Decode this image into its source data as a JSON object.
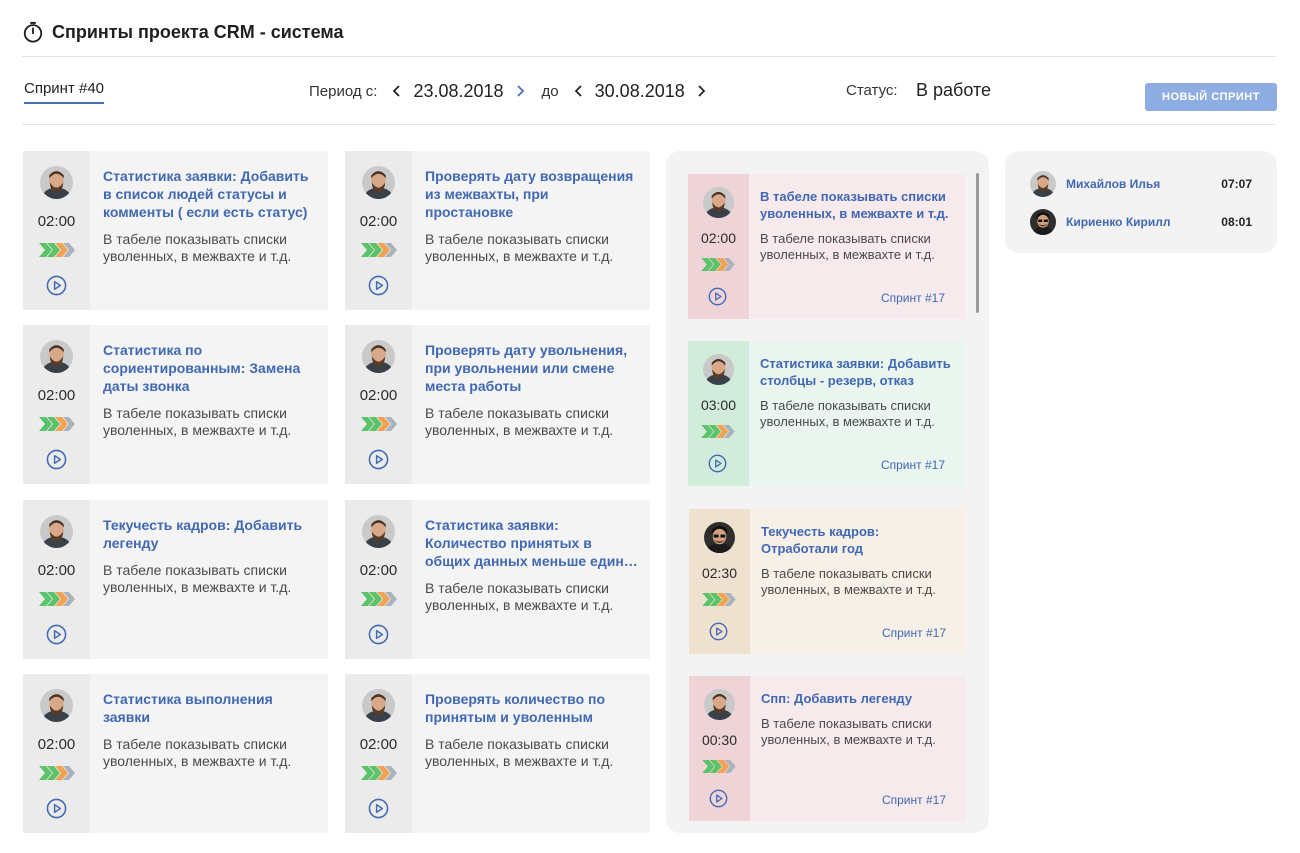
{
  "header": {
    "title": "Спринты проекта CRM - система",
    "icon": "stopwatch-icon"
  },
  "toolbar": {
    "sprint_tab": "Спринт #40",
    "period_label": "Период с:",
    "date_from": "23.08.2018",
    "to_label": "до",
    "date_to": "30.08.2018",
    "status_label": "Статус:",
    "status_value": "В работе",
    "new_sprint_button": "НОВЫЙ СПРИНТ"
  },
  "colors": {
    "accent": "#4068b3",
    "button": "#8eaee3",
    "arrow_green": "#5cc36a",
    "arrow_orange": "#f2a253",
    "arrow_gray": "#a9b3bd",
    "sprint_red_side": "#efd4d7",
    "sprint_red_body": "#f7eaec",
    "sprint_green_side": "#d2ecdc",
    "sprint_green_body": "#e9f5ee",
    "sprint_beige_side": "#efe1cf",
    "sprint_beige_body": "#f7f0e7"
  },
  "tasks": [
    {
      "time": "02:00",
      "title": "Статистика заявки: Добавить в список людей статусы и комменты ( если есть статус)",
      "desc": "В табеле показывать списки уволенных, в межвахте и т.д."
    },
    {
      "time": "02:00",
      "title": "Проверять дату возвращения из межвахты, при простановке",
      "desc": "В табеле показывать списки уволенных, в межвахте и т.д."
    },
    {
      "time": "02:00",
      "title": "Статистика по сориентированным: Замена даты звонка",
      "desc": "В табеле показывать списки уволенных, в межвахте и т.д."
    },
    {
      "time": "02:00",
      "title": "Проверять дату увольнения, при увольнении или смене места работы",
      "desc": "В табеле показывать списки уволенных, в межвахте и т.д."
    },
    {
      "time": "02:00",
      "title": "Текучесть кадров: Добавить легенду",
      "desc": "В табеле показывать списки уволенных, в межвахте и т.д."
    },
    {
      "time": "02:00",
      "title": "Статистика заявки: Количество принятых в общих данных меньше един…",
      "desc": "В табеле показывать списки уволенных, в межвахте и т.д."
    },
    {
      "time": "02:00",
      "title": "Статистика выполнения заявки",
      "desc": "В табеле показывать списки уволенных, в межвахте и т.д."
    },
    {
      "time": "02:00",
      "title": "Проверять количество по принятым и уволенным",
      "desc": "В табеле показывать списки уволенных, в межвахте и т.д."
    }
  ],
  "sprint_tasks": [
    {
      "time": "02:00",
      "title": "В табеле показывать списки уволенных, в межвахте и т.д.",
      "desc": "В табеле показывать списки уволенных, в межвахте и т.д.",
      "tag": "Спринт #17",
      "color": "red"
    },
    {
      "time": "03:00",
      "title": "Статистика заявки: Добавить столбцы - резерв, отказ",
      "desc": "В табеле показывать списки уволенных, в межвахте и т.д.",
      "tag": "Спринт #17",
      "color": "green"
    },
    {
      "time": "02:30",
      "title": "Текучесть кадров: Отработали год",
      "desc": "В табеле показывать списки уволенных, в межвахте и т.д.",
      "tag": "Спринт #17",
      "color": "beige"
    },
    {
      "time": "00:30",
      "title": "Спп: Добавить легенду",
      "desc": "В табеле показывать списки уволенных, в межвахте и т.д.",
      "tag": "Спринт #17",
      "color": "red"
    }
  ],
  "users": [
    {
      "name": "Михайлов Илья",
      "time": "07:07"
    },
    {
      "name": "Кириенко Кирилл",
      "time": "08:01"
    }
  ]
}
